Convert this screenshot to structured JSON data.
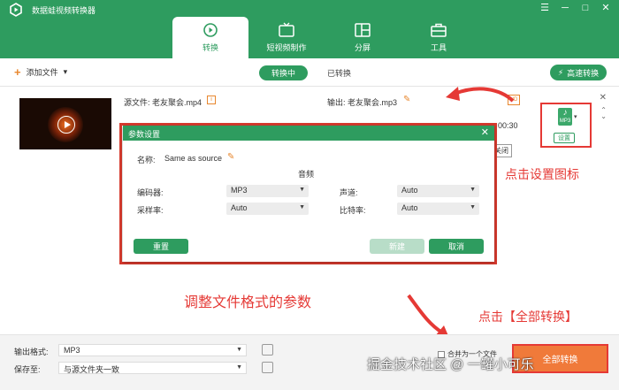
{
  "app": {
    "title": "数据蛙视频转换器"
  },
  "window": {
    "menu": "☰",
    "minimize": "─",
    "maximize": "□",
    "close": "✕"
  },
  "nav": {
    "tabs": [
      {
        "label": "转换",
        "icon": "convert-icon"
      },
      {
        "label": "短视频制作",
        "icon": "tv-icon"
      },
      {
        "label": "分屏",
        "icon": "split-screen-icon"
      },
      {
        "label": "工具",
        "icon": "toolbox-icon"
      }
    ]
  },
  "toolbar": {
    "add_file": "添加文件",
    "converting": "转换中",
    "converted": "已转换",
    "fast_convert": "高速转换"
  },
  "file": {
    "source_label": "源文件:",
    "source_name": "老友聚会.mp4",
    "output_label": "输出:",
    "output_name": "老友聚会.mp3",
    "duration": "00:30",
    "tooltip": "关闭",
    "format_badge": "MP3",
    "settings_label": "设置"
  },
  "dialog": {
    "title": "参数设置",
    "name_label": "名称:",
    "name_value": "Same as source",
    "section": "音频",
    "encoder_label": "编码器:",
    "encoder_value": "MP3",
    "channel_label": "声道:",
    "channel_value": "Auto",
    "sample_label": "采样率:",
    "sample_value": "Auto",
    "bitrate_label": "比特率:",
    "bitrate_value": "Auto",
    "reset": "重置",
    "new": "新建",
    "cancel": "取消"
  },
  "annotations": {
    "click_settings": "点击设置图标",
    "adjust_params": "调整文件格式的参数",
    "click_convert_all": "点击【全部转换】"
  },
  "bottom": {
    "output_format_label": "输出格式:",
    "output_format_value": "MP3",
    "save_to_label": "保存至:",
    "save_to_value": "与源文件夹一致",
    "merge_label": "合并为一个文件",
    "convert_all": "全部转换"
  },
  "watermark": "掘金技术社区 @ 一罐小可乐",
  "colors": {
    "brand": "#2e9c5f",
    "accent": "#e8872e",
    "annotation": "#e53935"
  }
}
